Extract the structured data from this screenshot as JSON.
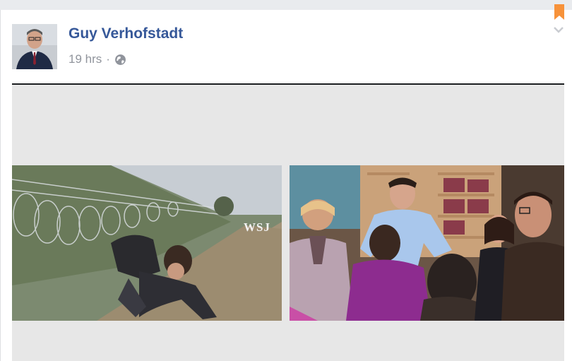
{
  "post": {
    "author_name": "Guy Verhofstadt",
    "timestamp": "19 hrs",
    "separator": "·",
    "privacy_icon": "globe-icon",
    "save_icon": "bookmark-ribbon-icon",
    "menu_icon": "chevron-down-icon"
  },
  "video": {
    "watermark": "WSJ",
    "left_scene": "border-fence-scene",
    "right_scene": "store-greeting-scene"
  },
  "colors": {
    "author_link": "#365899",
    "meta_text": "#90949c",
    "bookmark": "#f7923a",
    "page_bg": "#e9ebee"
  }
}
